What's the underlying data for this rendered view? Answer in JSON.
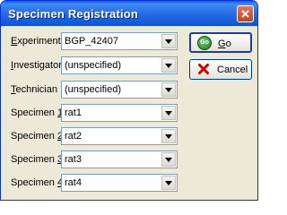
{
  "window": {
    "title": "Specimen Registration"
  },
  "fields": [
    {
      "label_pre": "",
      "label_key": "E",
      "label_post": "xperiment",
      "value": "BGP_42407"
    },
    {
      "label_pre": "",
      "label_key": "I",
      "label_post": "nvestigator",
      "value": "(unspecified)"
    },
    {
      "label_pre": "",
      "label_key": "T",
      "label_post": "echnician",
      "value": "(unspecified)"
    },
    {
      "label_pre": "Specimen ",
      "label_key": "1",
      "label_post": "",
      "value": "rat1"
    },
    {
      "label_pre": "Specimen ",
      "label_key": "2",
      "label_post": "",
      "value": "rat2"
    },
    {
      "label_pre": "Specimen ",
      "label_key": "3",
      "label_post": "",
      "value": "rat3"
    },
    {
      "label_pre": "Specimen ",
      "label_key": "4",
      "label_post": "",
      "value": "rat4"
    }
  ],
  "buttons": {
    "go": {
      "label_key": "G",
      "label_post": "o",
      "icon_text": "Go"
    },
    "cancel": {
      "label": "Cancel"
    }
  },
  "icons": {
    "close": "close-icon",
    "go": "go-icon",
    "cancel": "x-icon",
    "dropdown": "chevron-down-icon"
  },
  "colors": {
    "titlebar": "#2a6fe8",
    "close": "#c5411f",
    "go_icon": "#1a7a1a",
    "cancel_icon": "#cc0000"
  }
}
